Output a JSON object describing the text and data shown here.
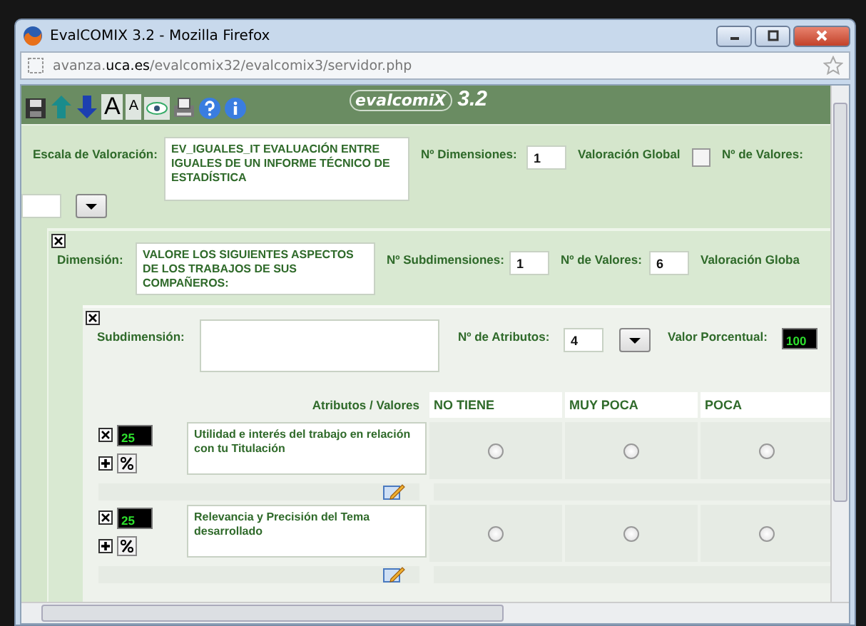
{
  "window": {
    "title": "EvalCOMIX 3.2 - Mozilla Firefox"
  },
  "address_bar": {
    "prefix": "avanza.",
    "host": "uca.es",
    "path": "/evalcomix32/evalcomix3/servidor.php"
  },
  "toolbar": {
    "font_buttons": [
      "A",
      "A"
    ],
    "logo": "evalcomiX",
    "version": "3.2"
  },
  "scale": {
    "label": "Escala de Valoración:",
    "name": "EV_IGUALES_IT EVALUACIÓN ENTRE IGUALES DE UN INFORME TÉCNICO DE ESTADÍSTICA",
    "dimensions_label": "Nº Dimensiones:",
    "dimensions": "1",
    "global_label": "Valoración Global",
    "global_checked": false,
    "values_label": "Nº de Valores:"
  },
  "dimension": {
    "label": "Dimensión:",
    "text": "VALORE LOS SIGUIENTES ASPECTOS DE LOS TRABAJOS DE SUS COMPAÑEROS:",
    "sub_label": "Nº Subdimensiones:",
    "sub": "1",
    "values_label": "Nº de Valores:",
    "values": "6",
    "global_label": "Valoración Globa"
  },
  "subdimension": {
    "label": "Subdimensión:",
    "attrs_label": "Nº de Atributos:",
    "attrs": "4",
    "percent_label": "Valor Porcentual:",
    "percent": "100"
  },
  "table": {
    "header": "Atributos / Valores",
    "columns": [
      "NO TIENE",
      "MUY POCA",
      "POCA"
    ],
    "rows": [
      {
        "percent": "25",
        "text": "Utilidad e interés del trabajo en relación con tu Titulación",
        "choices": [
          {
            "selected": false
          },
          {
            "selected": false
          },
          {
            "selected": false
          }
        ]
      },
      {
        "percent": "25",
        "text": "Relevancia y Precisión del Tema desarrollado",
        "choices": [
          {
            "selected": false
          },
          {
            "selected": false
          },
          {
            "selected": false
          }
        ]
      }
    ]
  }
}
